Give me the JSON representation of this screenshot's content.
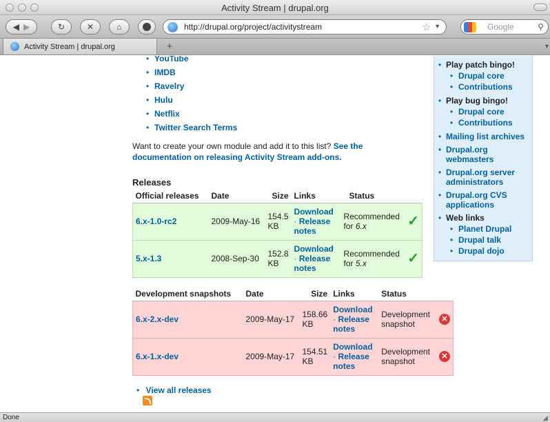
{
  "window": {
    "title": "Activity Stream | drupal.org"
  },
  "toolbar": {
    "back_icon": "back-arrow",
    "forward_icon": "forward-arrow",
    "reload_icon": "reload",
    "stop_icon": "stop-x",
    "home_icon": "home",
    "url": "http://drupal.org/project/activitystream",
    "search_placeholder": "Google"
  },
  "tabs": [
    {
      "label": "Activity Stream | drupal.org"
    }
  ],
  "content": {
    "services": [
      "YouTube",
      "IMDB",
      "Ravelry",
      "Hulu",
      "Netflix",
      "Twitter Search Terms"
    ],
    "intro_text": "Want to create your own module and add it to this list?",
    "intro_link": "See the documentation on releasing Activity Stream add-ons.",
    "releases_heading": "Releases",
    "official_table": {
      "headers": [
        "Official releases",
        "Date",
        "Size",
        "Links",
        "Status"
      ],
      "rows": [
        {
          "version": "6.x-1.0-rc2",
          "date": "2009-May-16",
          "size_num": "154.5",
          "size_unit": "KB",
          "download": "Download",
          "sep": "·",
          "notes1": "Release",
          "notes2": "notes",
          "status1": "Recommended",
          "status2_pre": "for ",
          "status2_em": "6.x"
        },
        {
          "version": "5.x-1.3",
          "date": "2008-Sep-30",
          "size_num": "152.8",
          "size_unit": "KB",
          "download": "Download",
          "sep": "·",
          "notes1": "Release",
          "notes2": "notes",
          "status1": "Recommended",
          "status2_pre": "for ",
          "status2_em": "5.x"
        }
      ]
    },
    "dev_table": {
      "headers": [
        "Development snapshots",
        "Date",
        "Size",
        "Links",
        "Status"
      ],
      "rows": [
        {
          "version": "6.x-2.x-dev",
          "date": "2009-May-17",
          "size_num": "158.66",
          "size_unit": "KB",
          "download": "Download",
          "sep": "·",
          "notes1": "Release",
          "notes2": "notes",
          "status1": "Development",
          "status2": "snapshot"
        },
        {
          "version": "6.x-1.x-dev",
          "date": "2009-May-17",
          "size_num": "154.51",
          "size_unit": "KB",
          "download": "Download",
          "sep": "·",
          "notes1": "Release",
          "notes2": "notes",
          "status1": "Development",
          "status2": "snapshot"
        }
      ]
    },
    "view_all": "View all releases"
  },
  "sidebar": {
    "patch_bingo": {
      "label": "Play patch bingo!",
      "items": [
        "Drupal core",
        "Contributions"
      ]
    },
    "bug_bingo": {
      "label": "Play bug bingo!",
      "items": [
        "Drupal core",
        "Contributions"
      ]
    },
    "links": [
      "Mailing list archives",
      "Drupal.org webmasters",
      "Drupal.org server administrators",
      "Drupal.org CVS applications"
    ],
    "web_links": {
      "label": "Web links",
      "items": [
        "Planet Drupal",
        "Drupal talk",
        "Drupal dojo"
      ]
    }
  },
  "statusbar": {
    "text": "Done"
  }
}
